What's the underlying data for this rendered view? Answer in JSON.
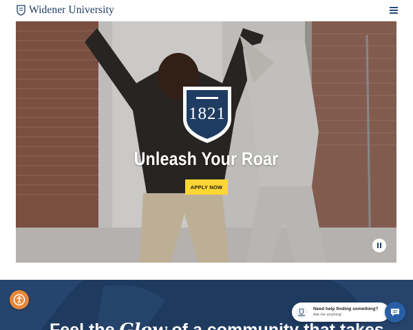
{
  "header": {
    "logo_text": "Widener University",
    "logo_icon": "widener-shield-icon",
    "menu_icon": "hamburger-menu-icon"
  },
  "hero": {
    "crest_year": "1821",
    "title": "Unleash Your Roar",
    "apply_label": "APPLY NOW",
    "pause_icon": "pause-icon"
  },
  "bottom": {
    "heading_before": "Feel the ",
    "heading_script": "Glow",
    "heading_after": " of a community that takes"
  },
  "chat": {
    "title": "Need help finding something?",
    "subtitle": "Ask me anything!",
    "avatar_icon": "widener-chat-avatar-icon",
    "button_icon": "chat-icon"
  },
  "a11y": {
    "icon": "accessibility-icon"
  },
  "colors": {
    "brand_navy": "#1f3c63",
    "apply_yellow": "#ffd633",
    "bottom_bg": "#1f3a5f",
    "a11y_orange": "#e8873a",
    "chat_blue": "#2a5fa8"
  }
}
